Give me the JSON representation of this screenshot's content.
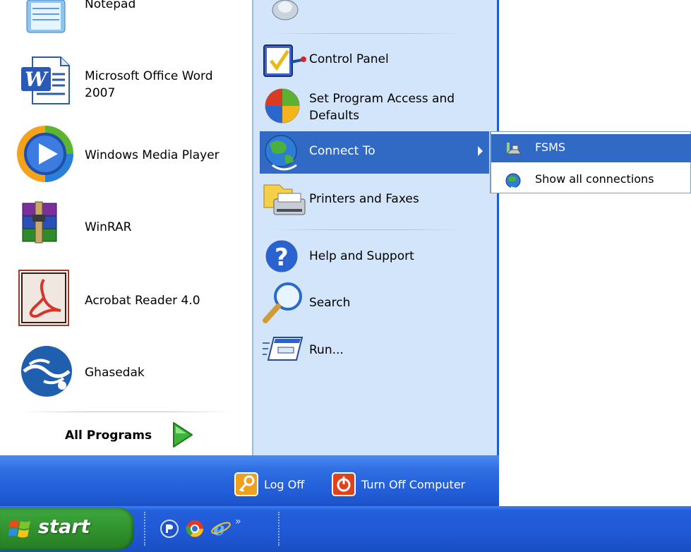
{
  "left_items": [
    {
      "label": "Notepad",
      "icon": "notepad-icon"
    },
    {
      "label": "Microsoft Office Word\n2007",
      "icon": "word-icon"
    },
    {
      "label": "Windows Media Player",
      "icon": "media-player-icon"
    },
    {
      "label": "WinRAR",
      "icon": "winrar-icon"
    },
    {
      "label": "Acrobat Reader 4.0",
      "icon": "acrobat-icon"
    },
    {
      "label": "Ghasedak",
      "icon": "ghasedak-icon"
    }
  ],
  "all_programs_label": "All Programs",
  "right_items": [
    {
      "label": "Control Panel",
      "icon": "control-panel-icon"
    },
    {
      "label": "Set Program Access and\nDefaults",
      "icon": "program-access-icon"
    },
    {
      "label": "Connect To",
      "icon": "connect-to-icon"
    },
    {
      "label": "Printers and Faxes",
      "icon": "printer-icon"
    },
    {
      "label": "Help and Support",
      "icon": "help-icon"
    },
    {
      "label": "Search",
      "icon": "search-icon"
    },
    {
      "label": "Run...",
      "icon": "run-icon"
    }
  ],
  "submenu": [
    {
      "label": "FSMS",
      "icon": "dialup-connection-icon"
    },
    {
      "label": "Show all connections",
      "icon": "network-globe-icon"
    }
  ],
  "footer": {
    "logoff_label": "Log Off",
    "turnoff_label": "Turn Off Computer"
  },
  "taskbar": {
    "start_label": "start",
    "chevron": "»"
  },
  "colors": {
    "highlight": "#316ac5",
    "menu_right_bg": "#d3e5fa",
    "taskbar_blue": "#245edb",
    "start_green": "#3aa33a"
  }
}
